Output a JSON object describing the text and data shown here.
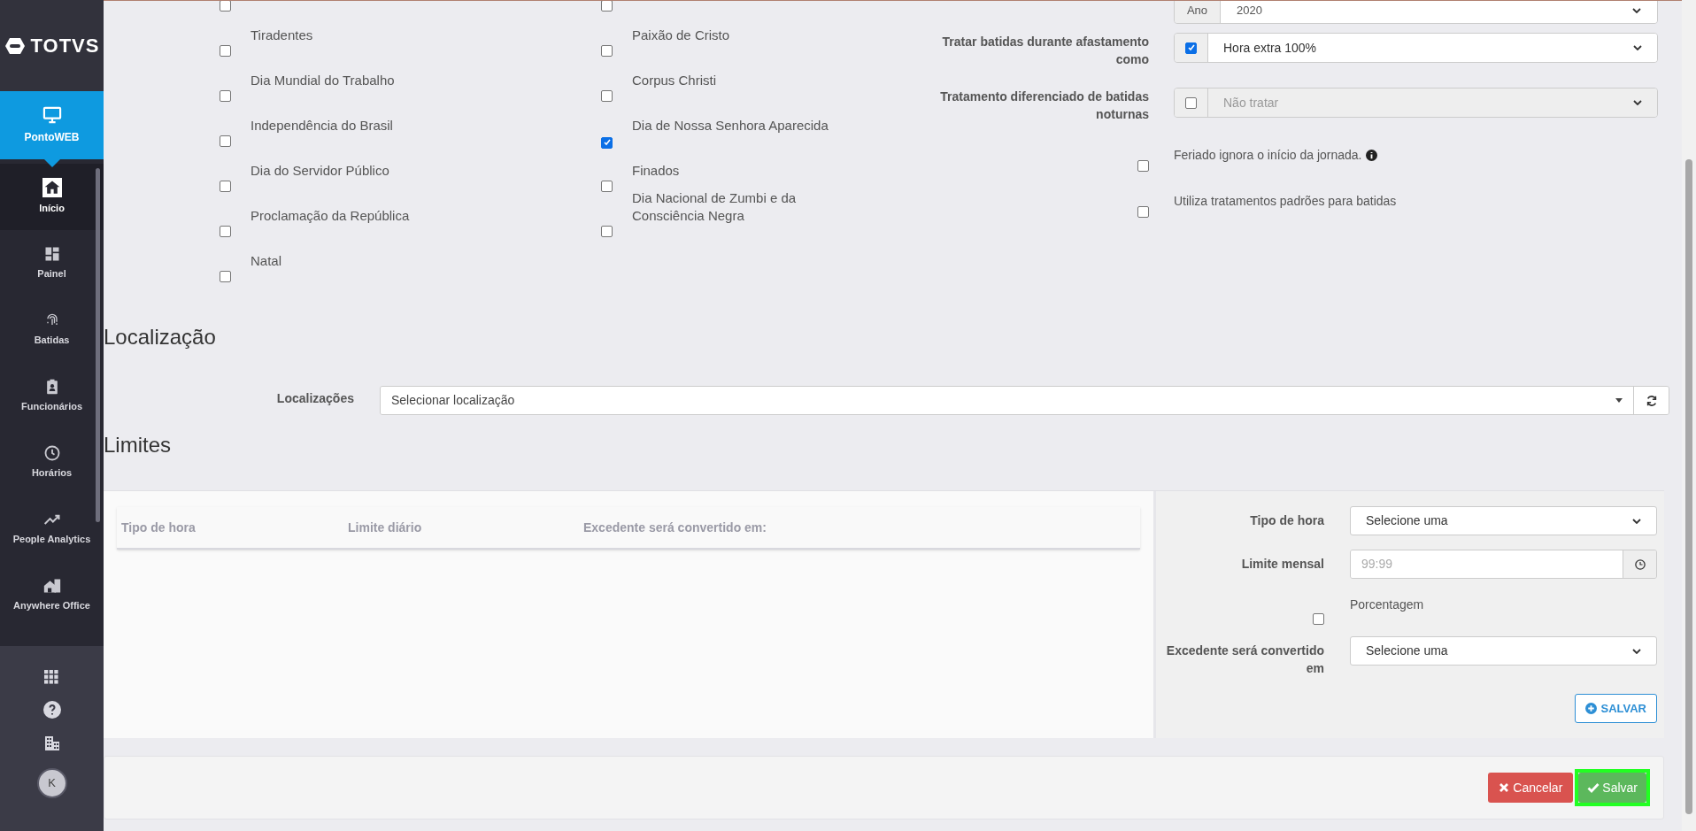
{
  "sidebar": {
    "logo": "TOTVS",
    "module": {
      "label": "PontoWEB",
      "selected": true
    },
    "items": [
      {
        "label": "Início",
        "selected": true
      },
      {
        "label": "Painel",
        "selected": false
      },
      {
        "label": "Batidas",
        "selected": false
      },
      {
        "label": "Funcionários",
        "selected": false
      },
      {
        "label": "Horários",
        "selected": false
      },
      {
        "label": "People Analytics",
        "selected": false
      },
      {
        "label": "Anywhere Office",
        "selected": false
      }
    ],
    "avatar": "K"
  },
  "holidays": {
    "column_1": [
      {
        "checked": false
      },
      {
        "label": "Tiradentes",
        "checked": false
      },
      {
        "label": "Dia Mundial do Trabalho",
        "checked": false
      },
      {
        "label": "Independência do Brasil",
        "checked": false
      },
      {
        "label": "Dia do Servidor Público",
        "checked": false
      },
      {
        "label": "Proclamação da República",
        "checked": false
      },
      {
        "label": "Natal",
        "checked": false
      }
    ],
    "column_2": [
      {
        "checked": false
      },
      {
        "label": "Paixão de Cristo",
        "checked": false
      },
      {
        "label": "Corpus Christi",
        "checked": false
      },
      {
        "label": "Dia de Nossa Senhora Aparecida",
        "checked": true
      },
      {
        "label": "Finados",
        "checked": false
      },
      {
        "label": "Dia Nacional de Zumbi e da Consciência Negra",
        "checked": false
      }
    ]
  },
  "settings": [
    {
      "kind": "addon-select",
      "addon": "Ano",
      "value": "2020"
    },
    {
      "kind": "check-select",
      "label": "Tratar batidas durante afastamento como",
      "checked": true,
      "value": "Hora extra 100%",
      "disabled": false
    },
    {
      "kind": "check-select",
      "label": "Tratamento diferenciado de batidas noturnas",
      "checked": false,
      "value": "Não tratar",
      "disabled": true
    },
    {
      "kind": "checkbox",
      "label": "Feriado ignora o início da jornada.",
      "checked": false,
      "info": true
    },
    {
      "kind": "checkbox",
      "label": "Utiliza tratamentos padrões para batidas",
      "checked": false,
      "info": false
    }
  ],
  "localizacao": {
    "title": "Localização",
    "label": "Localizações",
    "placeholder": "Selecionar localização"
  },
  "limites": {
    "title": "Limites",
    "table": {
      "columns": [
        "Tipo de hora",
        "Limite diário",
        "Excedente será convertido em:"
      ]
    },
    "form": {
      "tipo_label": "Tipo de hora",
      "tipo_value": "Selecione uma",
      "limite_label": "Limite mensal",
      "limite_placeholder": "99:99",
      "porcentagem_label": "Porcentagem",
      "porcentagem_checked": false,
      "excedente_label": "Excedente será convertido em",
      "excedente_value": "Selecione uma",
      "save": "SALVAR"
    }
  },
  "footer": {
    "cancel": "Cancelar",
    "save": "Salvar",
    "save_highlighted": true
  }
}
